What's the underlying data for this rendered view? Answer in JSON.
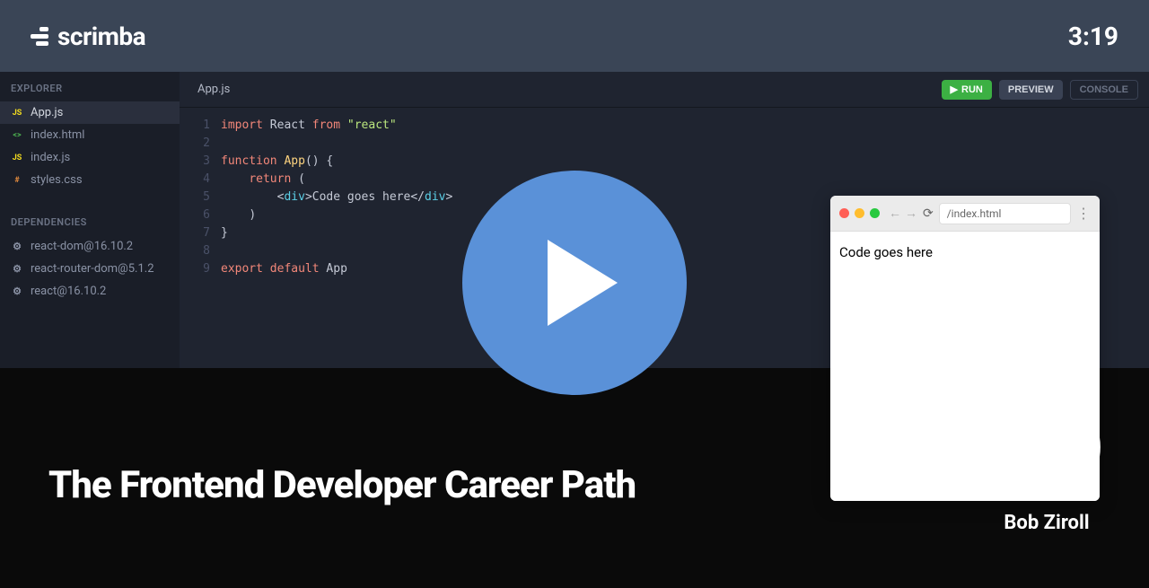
{
  "header": {
    "brand": "scrimba",
    "time": "3:19"
  },
  "sidebar": {
    "explorer_label": "EXPLORER",
    "dependencies_label": "DEPENDENCIES",
    "files": [
      {
        "name": "App.js",
        "type": "js",
        "active": true
      },
      {
        "name": "index.html",
        "type": "html",
        "active": false
      },
      {
        "name": "index.js",
        "type": "js",
        "active": false
      },
      {
        "name": "styles.css",
        "type": "css",
        "active": false
      }
    ],
    "dependencies": [
      {
        "name": "react-dom@16.10.2"
      },
      {
        "name": "react-router-dom@5.1.2"
      },
      {
        "name": "react@16.10.2"
      }
    ]
  },
  "editor": {
    "tab": "App.js",
    "buttons": {
      "run": "RUN",
      "preview": "PREVIEW",
      "console": "CONSOLE"
    },
    "lines": [
      "1",
      "2",
      "3",
      "4",
      "5",
      "6",
      "7",
      "8",
      "9"
    ],
    "code": {
      "l1_import": "import",
      "l1_react": " React ",
      "l1_from": "from",
      "l1_str": " \"react\"",
      "l3_func": "function",
      "l3_name": " App",
      "l3_rest": "() {",
      "l4_return": "return",
      "l4_rest": " (",
      "l5_open": "<",
      "l5_div": "div",
      "l5_close": ">",
      "l5_text": "Code goes here",
      "l5_endopen": "</",
      "l5_enddiv": "div",
      "l5_endclose": ">",
      "l6": ")",
      "l7": "}",
      "l9_export": "export",
      "l9_default": " default",
      "l9_app": " App"
    }
  },
  "preview": {
    "url": "/index.html",
    "content": "Code goes here"
  },
  "course": {
    "title": "The Frontend Developer Career Path",
    "instructor": "Bob Ziroll"
  }
}
